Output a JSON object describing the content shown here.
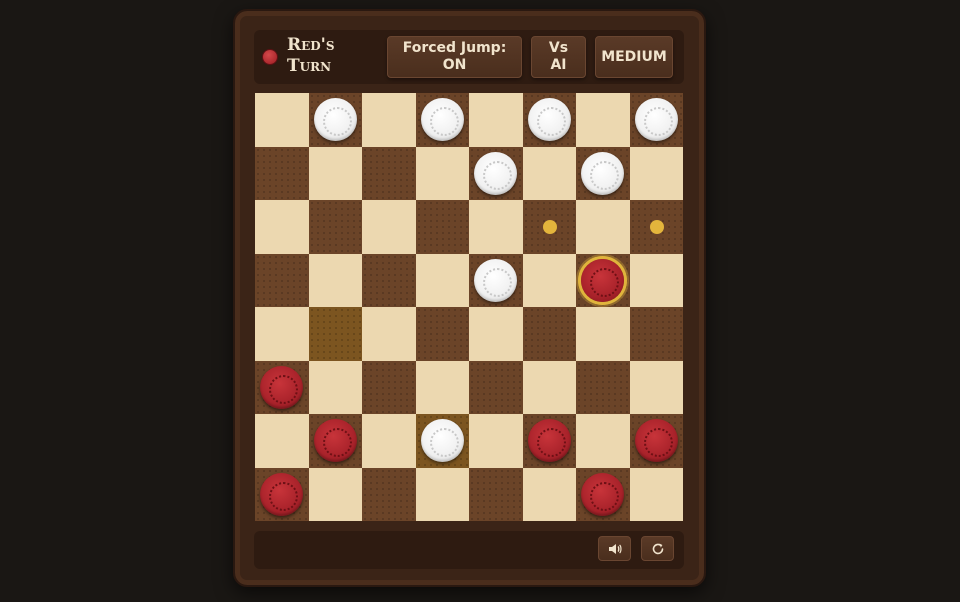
{
  "header": {
    "turn_label_line1": "Red's",
    "turn_label_line2": "Turn",
    "forced_jump_label": "Forced Jump:",
    "forced_jump_value": "ON",
    "mode_line1": "Vs",
    "mode_line2": "AI",
    "difficulty": "MEDIUM"
  },
  "colors": {
    "turn_color": "#b7262c",
    "highlight": "#e0b43c"
  },
  "board": {
    "size": 8,
    "pieces": [
      {
        "row": 0,
        "col": 1,
        "color": "white"
      },
      {
        "row": 0,
        "col": 3,
        "color": "white"
      },
      {
        "row": 0,
        "col": 5,
        "color": "white"
      },
      {
        "row": 0,
        "col": 7,
        "color": "white"
      },
      {
        "row": 1,
        "col": 4,
        "color": "white"
      },
      {
        "row": 1,
        "col": 6,
        "color": "white"
      },
      {
        "row": 3,
        "col": 4,
        "color": "white"
      },
      {
        "row": 3,
        "col": 6,
        "color": "red",
        "selected": true
      },
      {
        "row": 5,
        "col": 0,
        "color": "red"
      },
      {
        "row": 6,
        "col": 1,
        "color": "red"
      },
      {
        "row": 6,
        "col": 3,
        "color": "white"
      },
      {
        "row": 6,
        "col": 5,
        "color": "red"
      },
      {
        "row": 6,
        "col": 7,
        "color": "red"
      },
      {
        "row": 7,
        "col": 0,
        "color": "red"
      },
      {
        "row": 7,
        "col": 6,
        "color": "red"
      }
    ],
    "move_targets": [
      {
        "row": 2,
        "col": 5
      },
      {
        "row": 2,
        "col": 7
      }
    ],
    "highlighted_squares": [
      {
        "row": 4,
        "col": 1
      },
      {
        "row": 6,
        "col": 3
      }
    ]
  },
  "footer": {
    "sound_icon": "speaker-icon",
    "reset_icon": "refresh-icon"
  }
}
